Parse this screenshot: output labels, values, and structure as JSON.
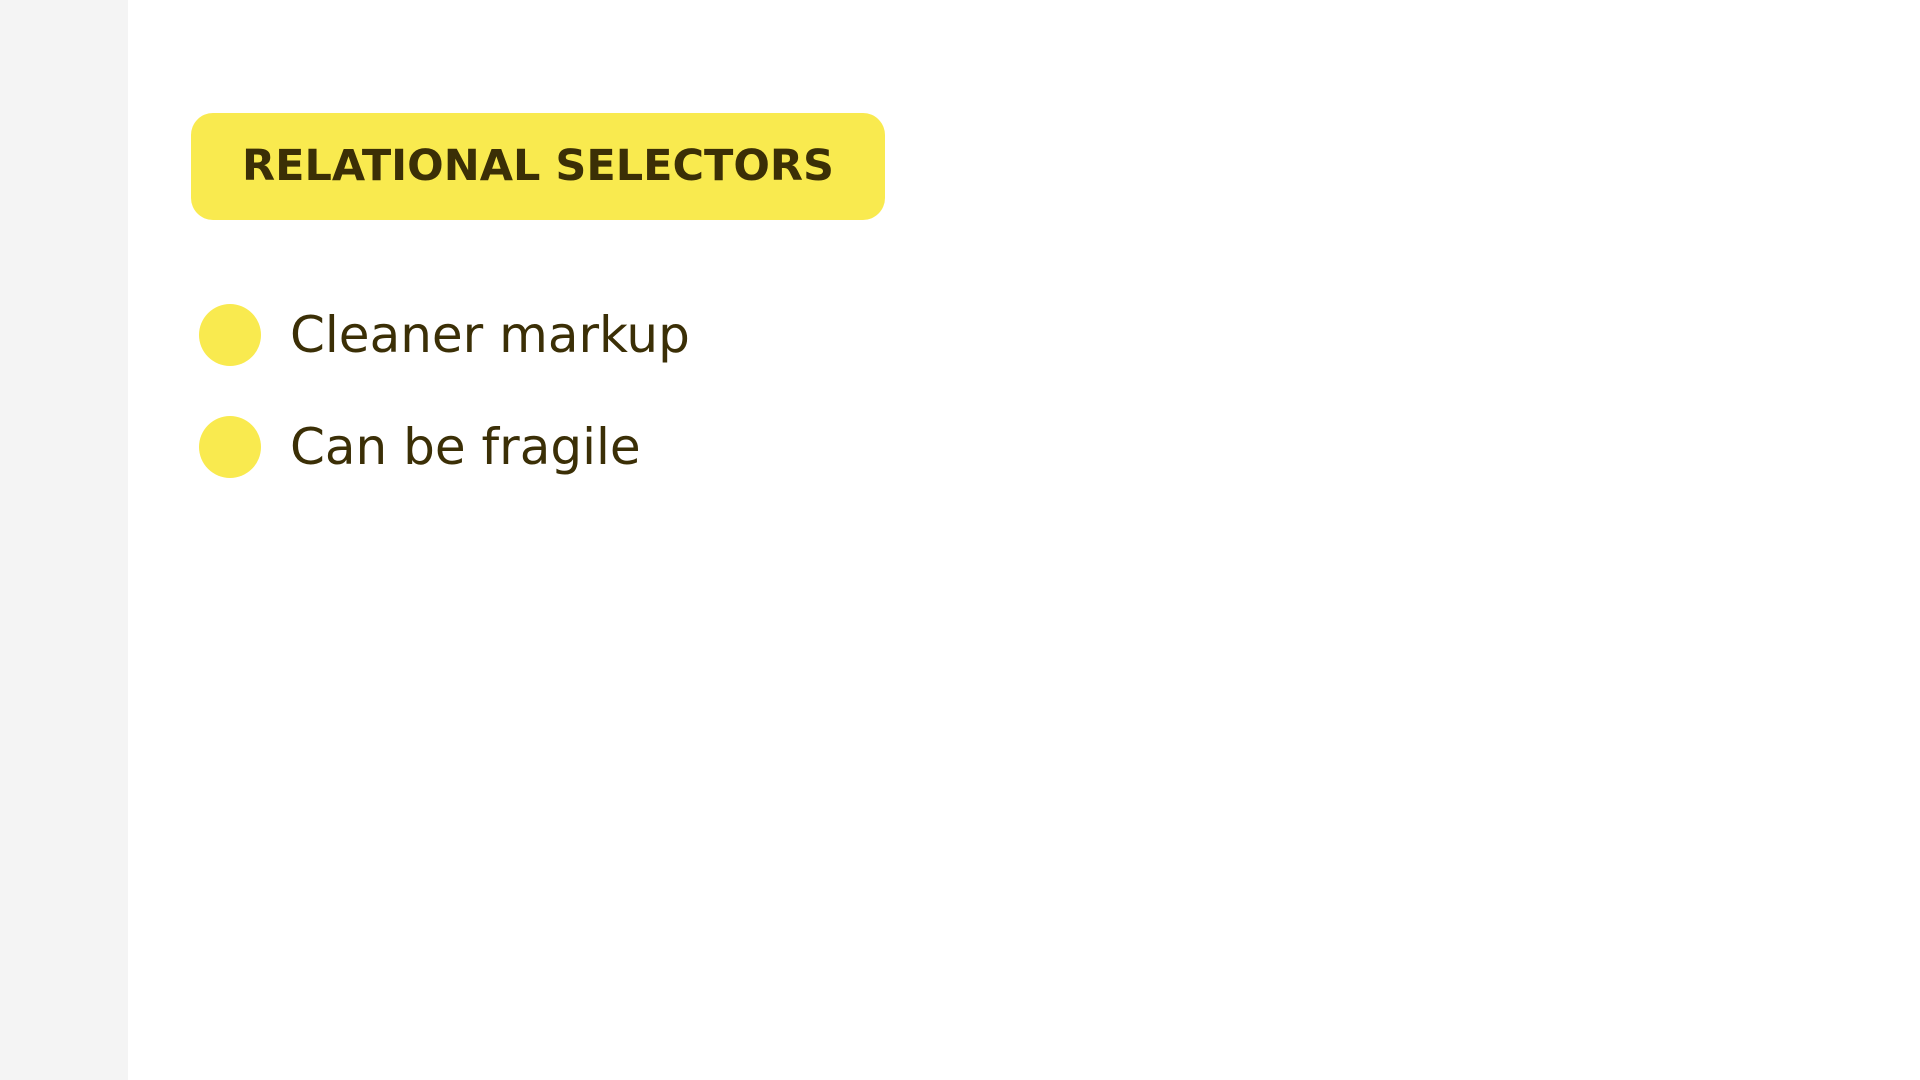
{
  "colors": {
    "accent": "#f9ea4f",
    "text": "#3b2f06",
    "sidebar_bg": "#f4f4f4",
    "content_bg": "#ffffff"
  },
  "slide": {
    "title": "RELATIONAL SELECTORS",
    "bullets": [
      {
        "label": "Cleaner markup",
        "icon": "bullet-dot-icon"
      },
      {
        "label": "Can be fragile",
        "icon": "bullet-dot-icon"
      }
    ]
  }
}
